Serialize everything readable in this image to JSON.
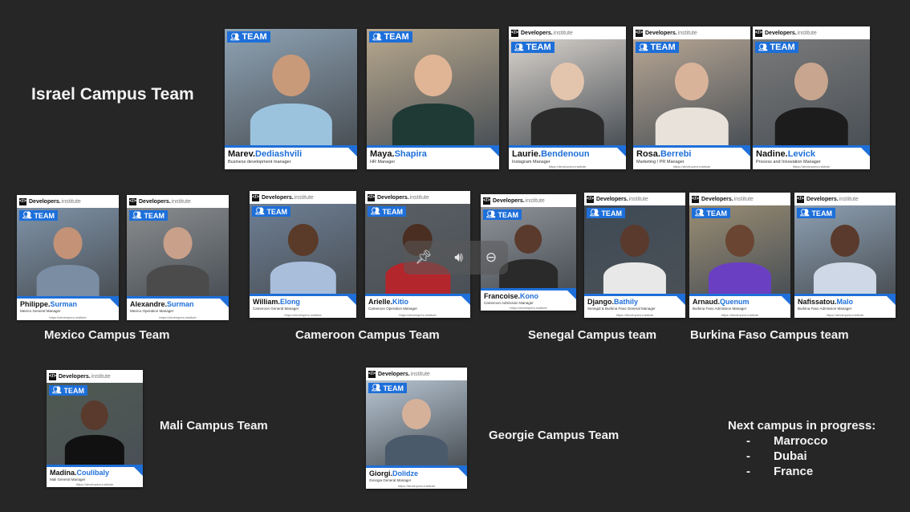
{
  "headings": {
    "israel": "Israel Campus Team",
    "mexico": "Mexico Campus Team",
    "cameroon": "Cameroon Campus Team",
    "senegal": "Senegal Campus team",
    "burkina": "Burkina Faso Campus team",
    "mali": "Mali Campus Team",
    "georgie": "Georgie Campus Team"
  },
  "next_campus": {
    "title": "Next campus in progress:",
    "items": [
      "Marrocco",
      "Dubai",
      "France"
    ]
  },
  "card_text": {
    "badge": "TEAM",
    "logo_brand": "Developers.",
    "logo_sub": "institute",
    "url": "https://developers.institute"
  },
  "cards": [
    {
      "first": "Marev.",
      "last": "Dediashvili",
      "role": "Business development manager"
    },
    {
      "first": "Maya.",
      "last": "Shapira",
      "role": "HR Manager"
    },
    {
      "first": "Laurie.",
      "last": "Bendenoun",
      "role": "Instagram Manager"
    },
    {
      "first": "Rosa.",
      "last": "Berrebi",
      "role": "Marketing / PR Manager"
    },
    {
      "first": "Nadine.",
      "last": "Levick",
      "role": "Process and Innovation Manager"
    },
    {
      "first": "Philippe.",
      "last": "Surman",
      "role": "Mexico General Manager"
    },
    {
      "first": "Alexandre.",
      "last": "Surman",
      "role": "Mexico Operation Manager"
    },
    {
      "first": "William.",
      "last": "Elong",
      "role": "Cameroon General Manager"
    },
    {
      "first": "Arielle.",
      "last": "Kitio",
      "role": "Cameroon Operation Manager"
    },
    {
      "first": "Francoise.",
      "last": "Kono",
      "role": "Cameroon Admission Manager"
    },
    {
      "first": "Django.",
      "last": "Bathily",
      "role": "Senegal & Burkina Faso General Manager"
    },
    {
      "first": "Arnaud.",
      "last": "Quenum",
      "role": "Burkina Faso Admission Manager"
    },
    {
      "first": "Nafissatou.",
      "last": "Malo",
      "role": "Burkina Faso Admission Manager"
    },
    {
      "first": "Madina.",
      "last": "Coulibaly",
      "role": "Mali General Manager"
    },
    {
      "first": "Giorgi.",
      "last": "Dolidze",
      "role": "Georgia General Manager"
    }
  ],
  "overlay_controls": {
    "pin_icon": "pin-icon",
    "speaker_icon": "speaker-icon",
    "minus_icon": "minus-circle-icon"
  },
  "colors": {
    "background": "#262626",
    "accent_blue": "#1e6fd9"
  }
}
